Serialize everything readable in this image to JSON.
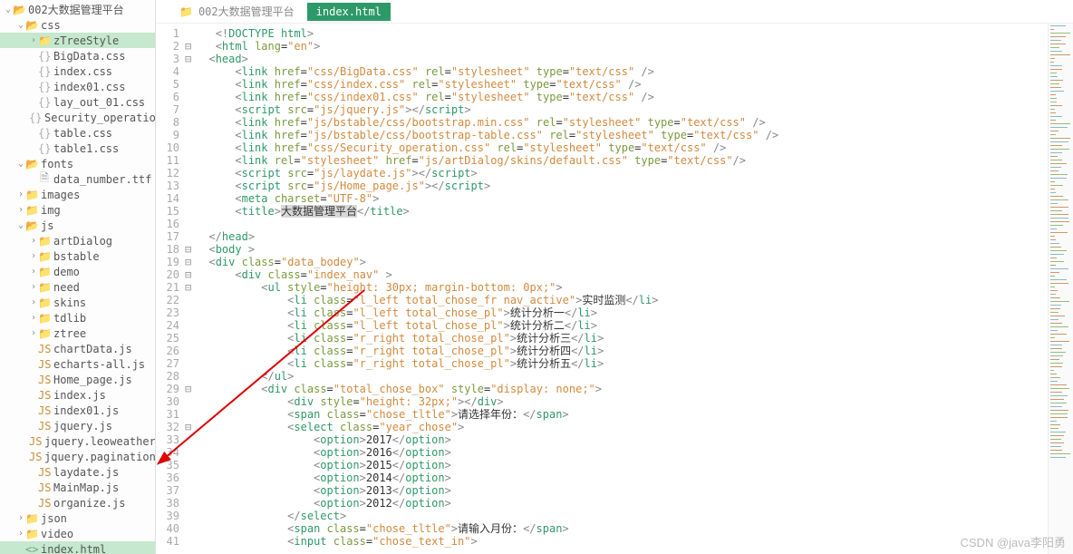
{
  "watermark": "CSDN @java李阳勇",
  "tabs": [
    {
      "icon": "📁",
      "label": "002大数据管理平台",
      "active": false
    },
    {
      "icon": "",
      "label": "index.html",
      "active": true
    }
  ],
  "tree": [
    {
      "d": 0,
      "c": "v",
      "i": "📂",
      "cls": "fold-o",
      "t": "002大数据管理平台"
    },
    {
      "d": 1,
      "c": "v",
      "i": "📂",
      "cls": "fold-o",
      "t": "css"
    },
    {
      "d": 2,
      "c": ">",
      "i": "📁",
      "cls": "fold",
      "t": "zTreeStyle",
      "sel": true
    },
    {
      "d": 2,
      "c": "",
      "i": "{}",
      "cls": "cssf",
      "t": "BigData.css"
    },
    {
      "d": 2,
      "c": "",
      "i": "{}",
      "cls": "cssf",
      "t": "index.css"
    },
    {
      "d": 2,
      "c": "",
      "i": "{}",
      "cls": "cssf",
      "t": "index01.css"
    },
    {
      "d": 2,
      "c": "",
      "i": "{}",
      "cls": "cssf",
      "t": "lay_out_01.css"
    },
    {
      "d": 2,
      "c": "",
      "i": "{}",
      "cls": "cssf",
      "t": "Security_operation.css"
    },
    {
      "d": 2,
      "c": "",
      "i": "{}",
      "cls": "cssf",
      "t": "table.css"
    },
    {
      "d": 2,
      "c": "",
      "i": "{}",
      "cls": "cssf",
      "t": "table1.css"
    },
    {
      "d": 1,
      "c": "v",
      "i": "📂",
      "cls": "fold-o",
      "t": "fonts"
    },
    {
      "d": 2,
      "c": "",
      "i": "🗎",
      "cls": "txtf",
      "t": "data_number.ttf"
    },
    {
      "d": 1,
      "c": ">",
      "i": "📁",
      "cls": "fold",
      "t": "images"
    },
    {
      "d": 1,
      "c": ">",
      "i": "📁",
      "cls": "fold",
      "t": "img"
    },
    {
      "d": 1,
      "c": "v",
      "i": "📂",
      "cls": "fold-o",
      "t": "js"
    },
    {
      "d": 2,
      "c": ">",
      "i": "📁",
      "cls": "fold",
      "t": "artDialog"
    },
    {
      "d": 2,
      "c": ">",
      "i": "📁",
      "cls": "fold",
      "t": "bstable"
    },
    {
      "d": 2,
      "c": ">",
      "i": "📁",
      "cls": "fold",
      "t": "demo"
    },
    {
      "d": 2,
      "c": ">",
      "i": "📁",
      "cls": "fold",
      "t": "need"
    },
    {
      "d": 2,
      "c": ">",
      "i": "📁",
      "cls": "fold",
      "t": "skins"
    },
    {
      "d": 2,
      "c": ">",
      "i": "📁",
      "cls": "fold",
      "t": "tdlib"
    },
    {
      "d": 2,
      "c": ">",
      "i": "📁",
      "cls": "fold",
      "t": "ztree"
    },
    {
      "d": 2,
      "c": "",
      "i": "JS",
      "cls": "jsf",
      "t": "chartData.js"
    },
    {
      "d": 2,
      "c": "",
      "i": "JS",
      "cls": "jsf",
      "t": "echarts-all.js"
    },
    {
      "d": 2,
      "c": "",
      "i": "JS",
      "cls": "jsf",
      "t": "Home_page.js"
    },
    {
      "d": 2,
      "c": "",
      "i": "JS",
      "cls": "jsf",
      "t": "index.js"
    },
    {
      "d": 2,
      "c": "",
      "i": "JS",
      "cls": "jsf",
      "t": "index01.js"
    },
    {
      "d": 2,
      "c": "",
      "i": "JS",
      "cls": "jsf",
      "t": "jquery.js"
    },
    {
      "d": 2,
      "c": "",
      "i": "JS",
      "cls": "jsf",
      "t": "jquery.leoweather.min.js"
    },
    {
      "d": 2,
      "c": "",
      "i": "JS",
      "cls": "jsf",
      "t": "jquery.pagination.js"
    },
    {
      "d": 2,
      "c": "",
      "i": "JS",
      "cls": "jsf",
      "t": "laydate.js"
    },
    {
      "d": 2,
      "c": "",
      "i": "JS",
      "cls": "jsf",
      "t": "MainMap.js"
    },
    {
      "d": 2,
      "c": "",
      "i": "JS",
      "cls": "jsf",
      "t": "organize.js"
    },
    {
      "d": 1,
      "c": ">",
      "i": "📁",
      "cls": "fold",
      "t": "json"
    },
    {
      "d": 1,
      "c": ">",
      "i": "📁",
      "cls": "fold",
      "t": "video"
    },
    {
      "d": 1,
      "c": "",
      "i": "<>",
      "cls": "htmlf",
      "t": "index.html",
      "sel": true
    }
  ],
  "code": [
    {
      "n": 1,
      "f": "",
      "h": "   <span class='t-punc'>&lt;!</span><span class='t-tag'>DOCTYPE html</span><span class='t-punc'>&gt;</span>"
    },
    {
      "n": 2,
      "f": "⊟",
      "h": "   <span class='t-punc'>&lt;</span><span class='t-tag'>html</span> <span class='t-attr'>lang</span>=<span class='t-str'>\"en\"</span><span class='t-punc'>&gt;</span>"
    },
    {
      "n": 3,
      "f": "⊟",
      "h": "  <span class='t-punc'>&lt;</span><span class='t-tag'>head</span><span class='t-punc'>&gt;</span>"
    },
    {
      "n": 4,
      "f": "",
      "h": "      <span class='t-punc'>&lt;</span><span class='t-tag'>link</span> <span class='t-attr'>href</span>=<span class='t-str'>\"css/BigData.css\"</span> <span class='t-attr'>rel</span>=<span class='t-str'>\"stylesheet\"</span> <span class='t-attr'>type</span>=<span class='t-str'>\"text/css\"</span> <span class='t-punc'>/&gt;</span>"
    },
    {
      "n": 5,
      "f": "",
      "h": "      <span class='t-punc'>&lt;</span><span class='t-tag'>link</span> <span class='t-attr'>href</span>=<span class='t-str'>\"css/index.css\"</span> <span class='t-attr'>rel</span>=<span class='t-str'>\"stylesheet\"</span> <span class='t-attr'>type</span>=<span class='t-str'>\"text/css\"</span> <span class='t-punc'>/&gt;</span>"
    },
    {
      "n": 6,
      "f": "",
      "h": "      <span class='t-punc'>&lt;</span><span class='t-tag'>link</span> <span class='t-attr'>href</span>=<span class='t-str'>\"css/index01.css\"</span> <span class='t-attr'>rel</span>=<span class='t-str'>\"stylesheet\"</span> <span class='t-attr'>type</span>=<span class='t-str'>\"text/css\"</span> <span class='t-punc'>/&gt;</span>"
    },
    {
      "n": 7,
      "f": "",
      "h": "      <span class='t-punc'>&lt;</span><span class='t-tag'>script</span> <span class='t-attr'>src</span>=<span class='t-str'>\"js/jquery.js\"</span><span class='t-punc'>&gt;&lt;/</span><span class='t-tag'>script</span><span class='t-punc'>&gt;</span>"
    },
    {
      "n": 8,
      "f": "",
      "h": "      <span class='t-punc'>&lt;</span><span class='t-tag'>link</span> <span class='t-attr'>href</span>=<span class='t-str'>\"js/bstable/css/bootstrap.min.css\"</span> <span class='t-attr'>rel</span>=<span class='t-str'>\"stylesheet\"</span> <span class='t-attr'>type</span>=<span class='t-str'>\"text/css\"</span> <span class='t-punc'>/&gt;</span>"
    },
    {
      "n": 9,
      "f": "",
      "h": "      <span class='t-punc'>&lt;</span><span class='t-tag'>link</span> <span class='t-attr'>href</span>=<span class='t-str'>\"js/bstable/css/bootstrap-table.css\"</span> <span class='t-attr'>rel</span>=<span class='t-str'>\"stylesheet\"</span> <span class='t-attr'>type</span>=<span class='t-str'>\"text/css\"</span> <span class='t-punc'>/&gt;</span>"
    },
    {
      "n": 10,
      "f": "",
      "h": "      <span class='t-punc'>&lt;</span><span class='t-tag'>link</span> <span class='t-attr'>href</span>=<span class='t-str'>\"css/Security_operation.css\"</span> <span class='t-attr'>rel</span>=<span class='t-str'>\"stylesheet\"</span> <span class='t-attr'>type</span>=<span class='t-str'>\"text/css\"</span> <span class='t-punc'>/&gt;</span>"
    },
    {
      "n": 11,
      "f": "",
      "h": "      <span class='t-punc'>&lt;</span><span class='t-tag'>link</span> <span class='t-attr'>rel</span>=<span class='t-str'>\"stylesheet\"</span> <span class='t-attr'>href</span>=<span class='t-str'>\"js/artDialog/skins/default.css\"</span> <span class='t-attr'>type</span>=<span class='t-str'>\"text/css\"</span><span class='t-punc'>/&gt;</span>"
    },
    {
      "n": 12,
      "f": "",
      "h": "      <span class='t-punc'>&lt;</span><span class='t-tag'>script</span> <span class='t-attr'>src</span>=<span class='t-str'>\"js/laydate.js\"</span><span class='t-punc'>&gt;&lt;/</span><span class='t-tag'>script</span><span class='t-punc'>&gt;</span>"
    },
    {
      "n": 13,
      "f": "",
      "h": "      <span class='t-punc'>&lt;</span><span class='t-tag'>script</span> <span class='t-attr'>src</span>=<span class='t-str'>\"js/Home_page.js\"</span><span class='t-punc'>&gt;&lt;/</span><span class='t-tag'>script</span><span class='t-punc'>&gt;</span>"
    },
    {
      "n": 14,
      "f": "",
      "h": "      <span class='t-punc'>&lt;</span><span class='t-tag'>meta</span> <span class='t-attr'>charset</span>=<span class='t-str'>\"UTF-8\"</span><span class='t-punc'>&gt;</span>"
    },
    {
      "n": 15,
      "f": "",
      "h": "      <span class='t-punc'>&lt;</span><span class='t-tag'>title</span><span class='t-punc'>&gt;</span><span class='hl'>大数据管理平台</span><span class='t-punc'>&lt;/</span><span class='t-tag'>title</span><span class='t-punc'>&gt;</span>"
    },
    {
      "n": 16,
      "f": "",
      "h": ""
    },
    {
      "n": 17,
      "f": "",
      "h": "  <span class='t-punc'>&lt;/</span><span class='t-tag'>head</span><span class='t-punc'>&gt;</span>"
    },
    {
      "n": 18,
      "f": "⊟",
      "h": "  <span class='t-punc'>&lt;</span><span class='t-tag'>body</span> <span class='t-punc'>&gt;</span>"
    },
    {
      "n": 19,
      "f": "⊟",
      "h": "  <span class='t-punc'>&lt;</span><span class='t-tag'>div</span> <span class='t-attr'>class</span>=<span class='t-str'>\"data_bodey\"</span><span class='t-punc'>&gt;</span>"
    },
    {
      "n": 20,
      "f": "⊟",
      "h": "      <span class='t-punc'>&lt;</span><span class='t-tag'>div</span> <span class='t-attr'>class</span>=<span class='t-str'>\"index_nav\"</span> <span class='t-punc'>&gt;</span>"
    },
    {
      "n": 21,
      "f": "⊟",
      "h": "          <span class='t-punc'>&lt;</span><span class='t-tag'>ul</span> <span class='t-attr'>style</span>=<span class='t-str'>\"height: 30px; margin-bottom: 0px;\"</span><span class='t-punc'>&gt;</span>"
    },
    {
      "n": 22,
      "f": "",
      "h": "              <span class='t-punc'>&lt;</span><span class='t-tag'>li</span> <span class='t-attr'>class</span>=<span class='t-str'>\"l_left total_chose_fr nav_active\"</span><span class='t-punc'>&gt;</span>实时监测<span class='t-punc'>&lt;/</span><span class='t-tag'>li</span><span class='t-punc'>&gt;</span>"
    },
    {
      "n": 23,
      "f": "",
      "h": "              <span class='t-punc'>&lt;</span><span class='t-tag'>li</span> <span class='t-attr'>class</span>=<span class='t-str'>\"l_left total_chose_pl\"</span><span class='t-punc'>&gt;</span>统计分析一<span class='t-punc'>&lt;/</span><span class='t-tag'>li</span><span class='t-punc'>&gt;</span>"
    },
    {
      "n": 24,
      "f": "",
      "h": "              <span class='t-punc'>&lt;</span><span class='t-tag'>li</span> <span class='t-attr'>class</span>=<span class='t-str'>\"l_left total_chose_pl\"</span><span class='t-punc'>&gt;</span>统计分析二<span class='t-punc'>&lt;/</span><span class='t-tag'>li</span><span class='t-punc'>&gt;</span>"
    },
    {
      "n": 25,
      "f": "",
      "h": "              <span class='t-punc'>&lt;</span><span class='t-tag'>li</span> <span class='t-attr'>class</span>=<span class='t-str'>\"r_right total_chose_pl\"</span><span class='t-punc'>&gt;</span>统计分析三<span class='t-punc'>&lt;/</span><span class='t-tag'>li</span><span class='t-punc'>&gt;</span>"
    },
    {
      "n": 26,
      "f": "",
      "h": "              <span class='t-punc'>&lt;</span><span class='t-tag'>li</span> <span class='t-attr'>class</span>=<span class='t-str'>\"r_right total_chose_pl\"</span><span class='t-punc'>&gt;</span>统计分析四<span class='t-punc'>&lt;/</span><span class='t-tag'>li</span><span class='t-punc'>&gt;</span>"
    },
    {
      "n": 27,
      "f": "",
      "h": "              <span class='t-punc'>&lt;</span><span class='t-tag'>li</span> <span class='t-attr'>class</span>=<span class='t-str'>\"r_right total_chose_pl\"</span><span class='t-punc'>&gt;</span>统计分析五<span class='t-punc'>&lt;/</span><span class='t-tag'>li</span><span class='t-punc'>&gt;</span>"
    },
    {
      "n": 28,
      "f": "",
      "h": "          <span class='t-punc'>&lt;/</span><span class='t-tag'>ul</span><span class='t-punc'>&gt;</span>"
    },
    {
      "n": 29,
      "f": "⊟",
      "h": "          <span class='t-punc'>&lt;</span><span class='t-tag'>div</span> <span class='t-attr'>class</span>=<span class='t-str'>\"total_chose_box\"</span> <span class='t-attr'>style</span>=<span class='t-str'>\"display: none;\"</span><span class='t-punc'>&gt;</span>"
    },
    {
      "n": 30,
      "f": "",
      "h": "              <span class='t-punc'>&lt;</span><span class='t-tag'>div</span> <span class='t-attr'>style</span>=<span class='t-str'>\"height: 32px;\"</span><span class='t-punc'>&gt;&lt;/</span><span class='t-tag'>div</span><span class='t-punc'>&gt;</span>"
    },
    {
      "n": 31,
      "f": "",
      "h": "              <span class='t-punc'>&lt;</span><span class='t-tag'>span</span> <span class='t-attr'>class</span>=<span class='t-str'>\"chose_tltle\"</span><span class='t-punc'>&gt;</span>请选择年份：<span class='t-punc'>&lt;/</span><span class='t-tag'>span</span><span class='t-punc'>&gt;</span>"
    },
    {
      "n": 32,
      "f": "⊟",
      "h": "              <span class='t-punc'>&lt;</span><span class='t-tag'>select</span> <span class='t-attr'>class</span>=<span class='t-str'>\"year_chose\"</span><span class='t-punc'>&gt;</span>"
    },
    {
      "n": 33,
      "f": "",
      "h": "                  <span class='t-punc'>&lt;</span><span class='t-tag'>option</span><span class='t-punc'>&gt;</span>2017<span class='t-punc'>&lt;/</span><span class='t-tag'>option</span><span class='t-punc'>&gt;</span>"
    },
    {
      "n": 34,
      "f": "",
      "h": "                  <span class='t-punc'>&lt;</span><span class='t-tag'>option</span><span class='t-punc'>&gt;</span>2016<span class='t-punc'>&lt;/</span><span class='t-tag'>option</span><span class='t-punc'>&gt;</span>"
    },
    {
      "n": 35,
      "f": "",
      "h": "                  <span class='t-punc'>&lt;</span><span class='t-tag'>option</span><span class='t-punc'>&gt;</span>2015<span class='t-punc'>&lt;/</span><span class='t-tag'>option</span><span class='t-punc'>&gt;</span>"
    },
    {
      "n": 36,
      "f": "",
      "h": "                  <span class='t-punc'>&lt;</span><span class='t-tag'>option</span><span class='t-punc'>&gt;</span>2014<span class='t-punc'>&lt;/</span><span class='t-tag'>option</span><span class='t-punc'>&gt;</span>"
    },
    {
      "n": 37,
      "f": "",
      "h": "                  <span class='t-punc'>&lt;</span><span class='t-tag'>option</span><span class='t-punc'>&gt;</span>2013<span class='t-punc'>&lt;/</span><span class='t-tag'>option</span><span class='t-punc'>&gt;</span>"
    },
    {
      "n": 38,
      "f": "",
      "h": "                  <span class='t-punc'>&lt;</span><span class='t-tag'>option</span><span class='t-punc'>&gt;</span>2012<span class='t-punc'>&lt;/</span><span class='t-tag'>option</span><span class='t-punc'>&gt;</span>"
    },
    {
      "n": 39,
      "f": "",
      "h": "              <span class='t-punc'>&lt;/</span><span class='t-tag'>select</span><span class='t-punc'>&gt;</span>"
    },
    {
      "n": 40,
      "f": "",
      "h": "              <span class='t-punc'>&lt;</span><span class='t-tag'>span</span> <span class='t-attr'>class</span>=<span class='t-str'>\"chose_tltle\"</span><span class='t-punc'>&gt;</span>请输入月份：<span class='t-punc'>&lt;/</span><span class='t-tag'>span</span><span class='t-punc'>&gt;</span>"
    },
    {
      "n": 41,
      "f": "",
      "h": "              <span class='t-punc'>&lt;</span><span class='t-tag'>input</span> <span class='t-attr'>class</span>=<span class='t-str'>\"chose_text_in\"</span><span class='t-punc'>&gt;</span>"
    }
  ]
}
